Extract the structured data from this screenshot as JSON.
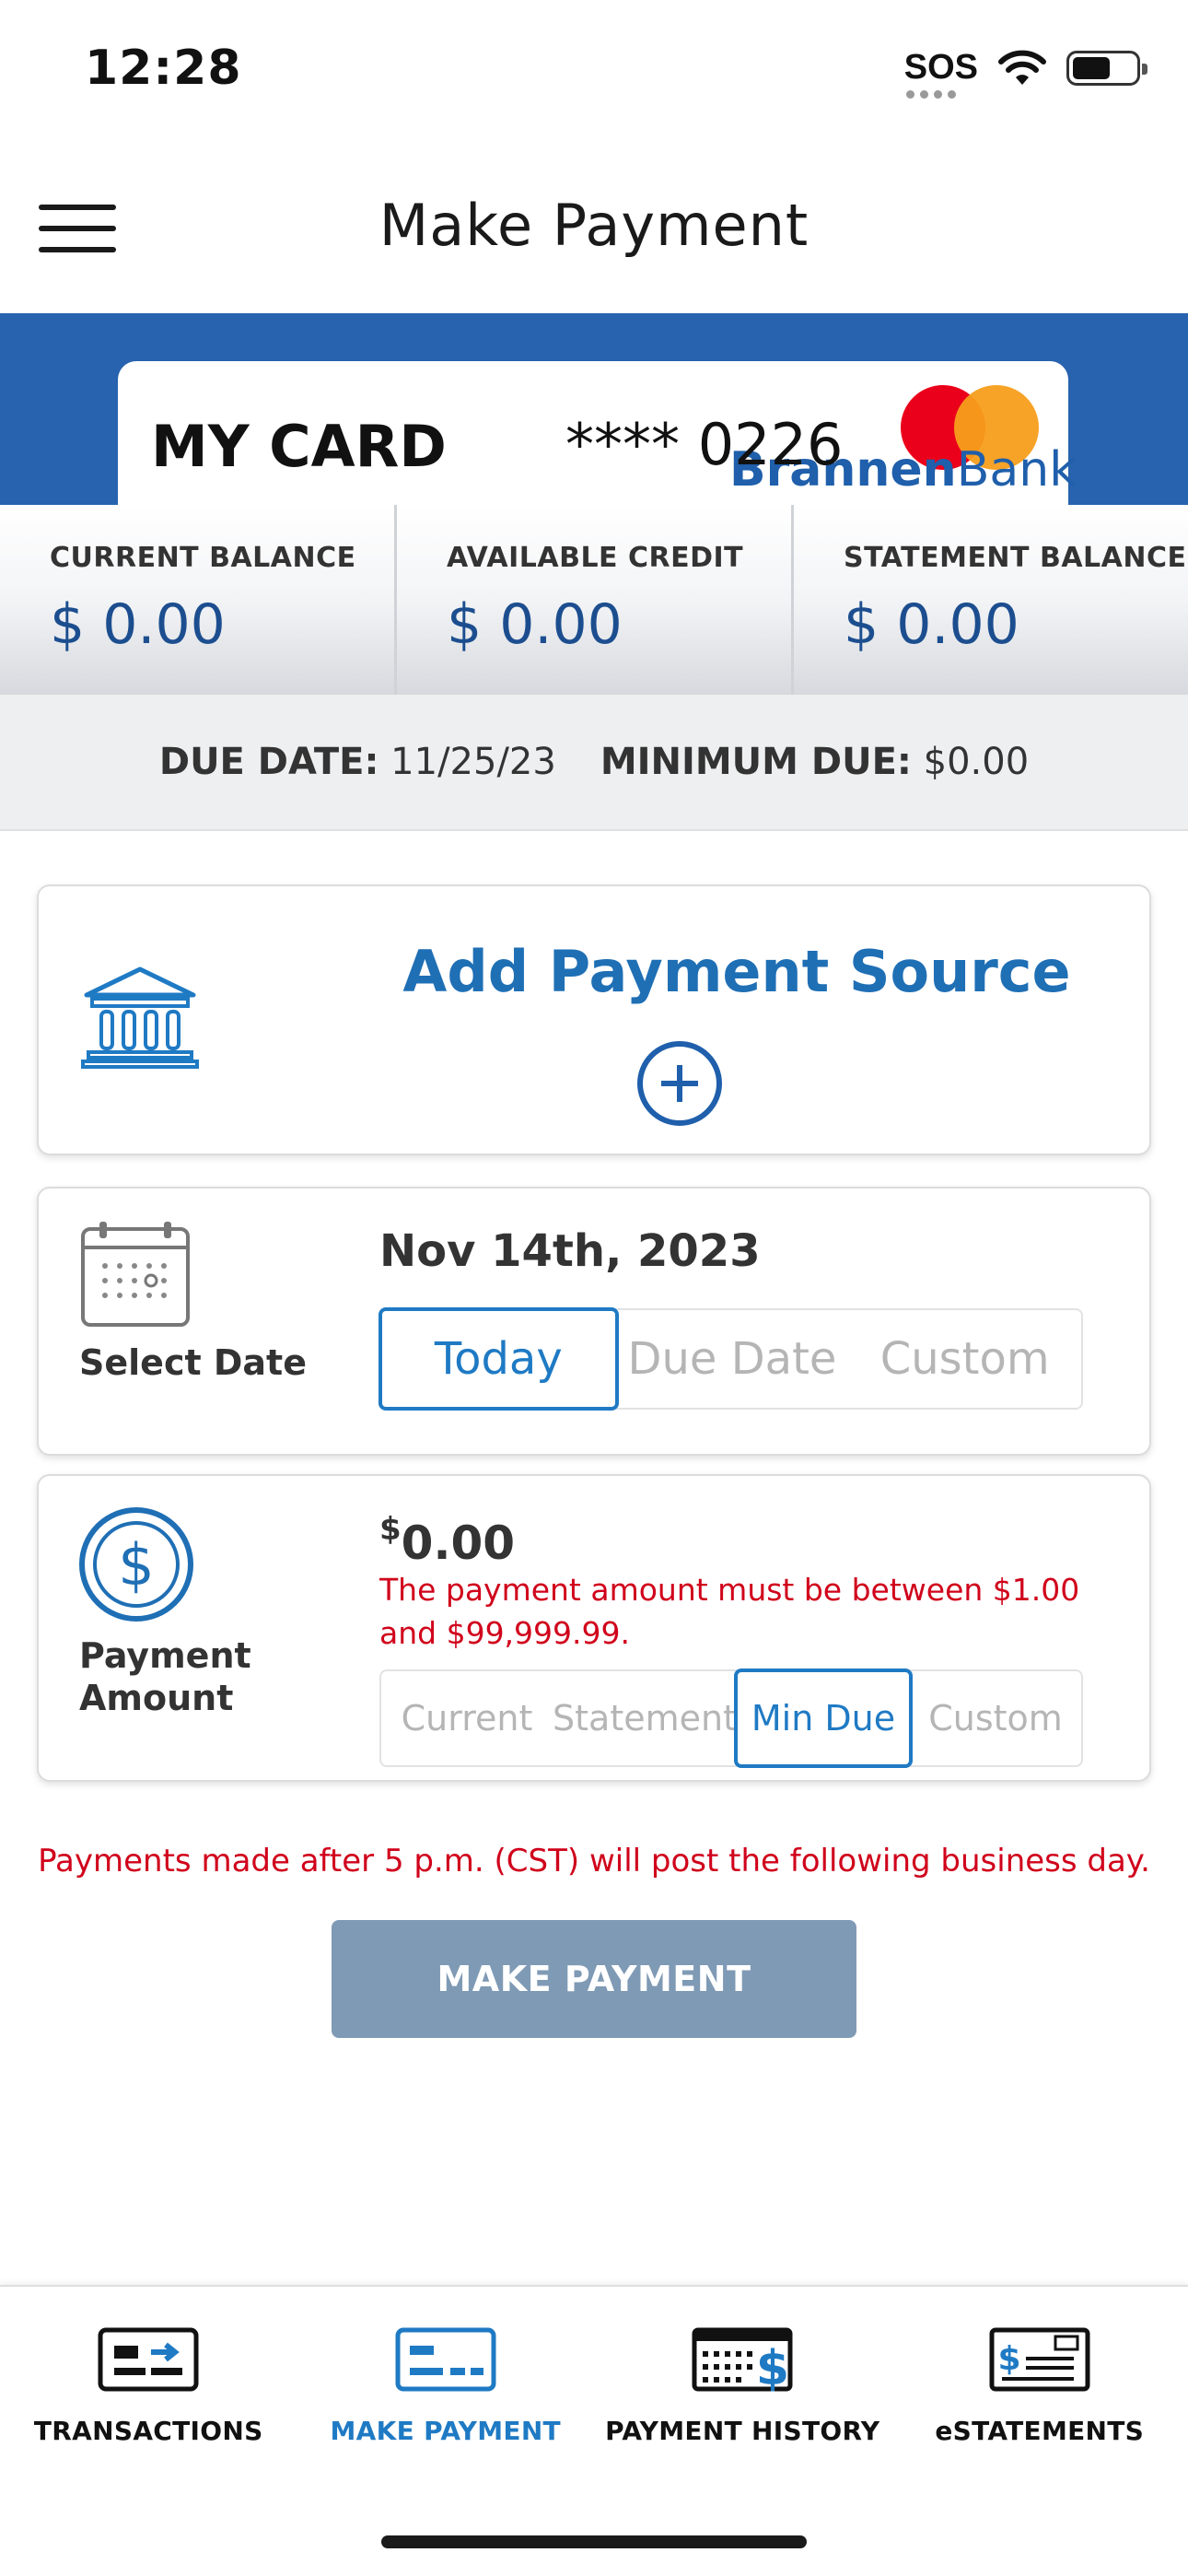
{
  "status_bar": {
    "time": "12:28",
    "sos": "SOS"
  },
  "header": {
    "title": "Make Payment"
  },
  "card": {
    "name": "MY CARD",
    "number": "**** 0226",
    "bank_name_bold": "Brannen",
    "bank_name_thin": "Bank",
    "network_logo": "mastercard-logo",
    "colors": {
      "banner": "#2763ae",
      "mc_red": "#eb001b",
      "mc_orange": "#f79e1b"
    }
  },
  "balances": [
    {
      "label": "CURRENT BALANCE",
      "value": "$ 0.00"
    },
    {
      "label": "AVAILABLE CREDIT",
      "value": "$ 0.00"
    },
    {
      "label": "STATEMENT BALANCE",
      "value": "$ 0.00"
    }
  ],
  "due": {
    "due_date_label": "DUE DATE:",
    "due_date_value": "11/25/23",
    "minimum_due_label": "MINIMUM DUE:",
    "minimum_due_value": "$0.00"
  },
  "payment_source": {
    "label": "Add Payment Source",
    "icon": "bank-icon",
    "add_icon": "plus-circle-icon"
  },
  "select_date": {
    "label": "Select Date",
    "value": "Nov 14th, 2023",
    "options": [
      "Today",
      "Due Date",
      "Custom"
    ],
    "selected": "Today"
  },
  "payment_amount": {
    "label": "Payment Amount",
    "label_line1": "Payment",
    "label_line2": "Amount",
    "currency": "$",
    "value": "0.00",
    "error": "The payment amount must be between $1.00 and $99,999.99.",
    "options": [
      "Current",
      "Statement",
      "Min Due",
      "Custom"
    ],
    "selected": "Min Due"
  },
  "cutoff_note": "Payments made after 5 p.m. (CST) will post the following business day.",
  "make_payment_button": "MAKE PAYMENT",
  "bottom_nav": {
    "items": [
      {
        "label": "TRANSACTIONS",
        "icon": "transactions-icon"
      },
      {
        "label": "MAKE PAYMENT",
        "icon": "make-payment-icon",
        "active": true
      },
      {
        "label": "PAYMENT HISTORY",
        "icon": "payment-history-icon"
      },
      {
        "label": "eSTATEMENTS",
        "icon": "estatements-icon"
      }
    ]
  },
  "colors": {
    "accent": "#1f7ac4",
    "error": "#d0021b",
    "button_disabled": "#7f9ab5"
  }
}
